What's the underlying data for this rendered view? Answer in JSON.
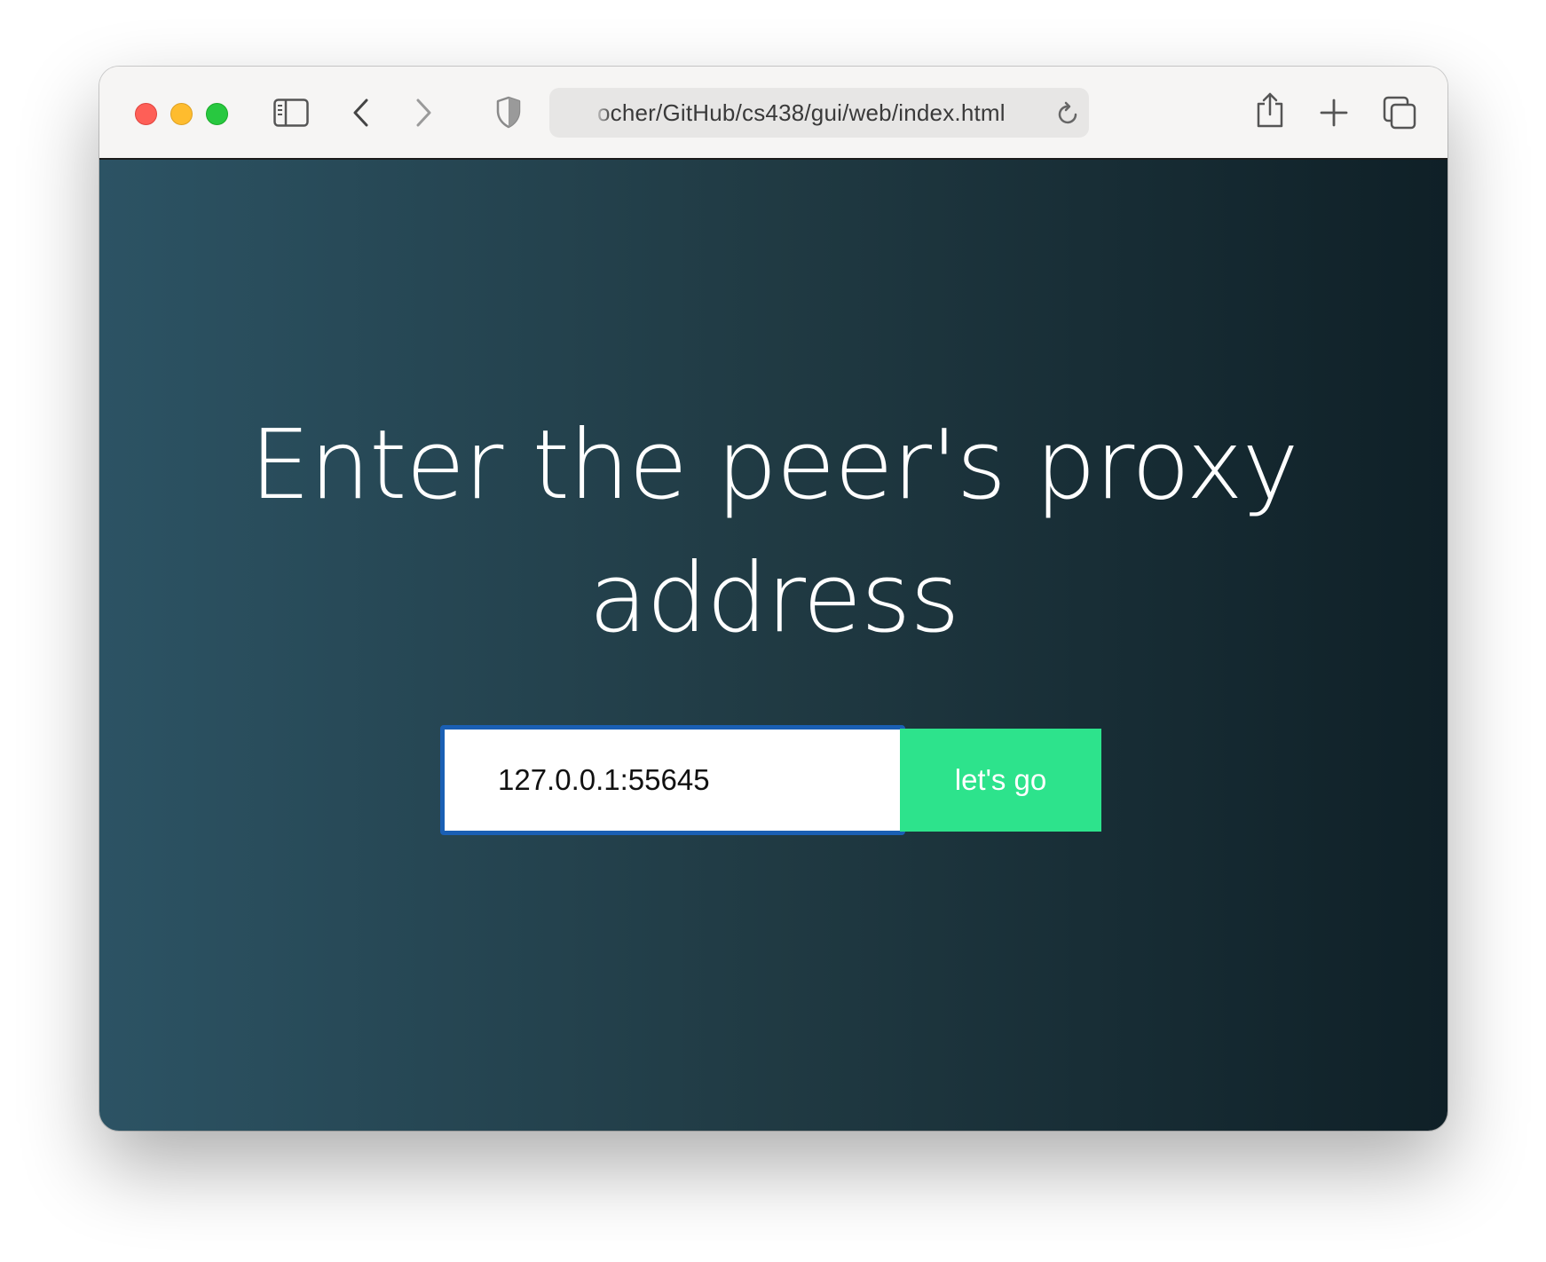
{
  "browser": {
    "address_bar": {
      "url_text": "ocher/GitHub/cs438/gui/web/index.html"
    },
    "icons": {
      "sidebar": "sidebar-icon",
      "back": "chevron-left-icon",
      "forward": "chevron-right-icon",
      "shield": "shield-icon",
      "reload": "reload-icon",
      "share": "share-icon",
      "new_tab": "plus-icon",
      "tabs": "tab-overview-icon"
    }
  },
  "page": {
    "headline": "Enter the peer's proxy address",
    "address_input": {
      "value": "127.0.0.1:55645"
    },
    "submit_label": "let's go"
  },
  "colors": {
    "gradient_start": "#2c5364",
    "gradient_mid": "#203a43",
    "gradient_end": "#0f2027",
    "button": "#2de38c",
    "input_focus_border": "#1a5fb4"
  }
}
